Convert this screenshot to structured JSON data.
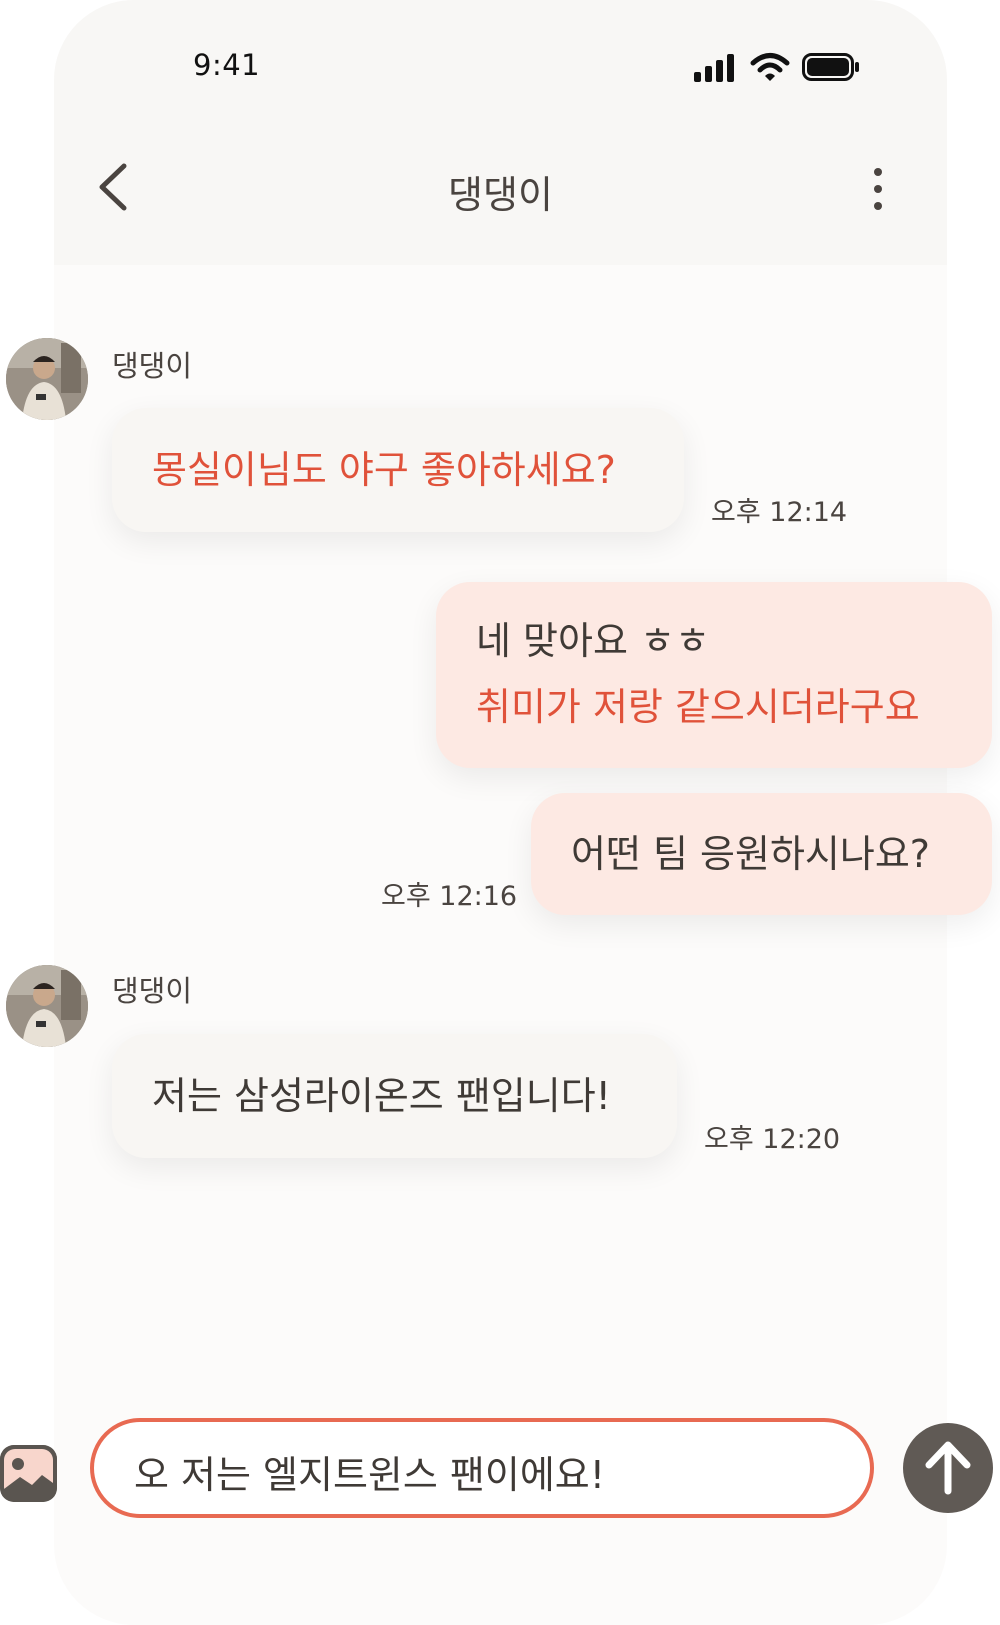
{
  "status_bar": {
    "time": "9:41"
  },
  "header": {
    "title": "댕댕이"
  },
  "messages": [
    {
      "sender": "댕댕이",
      "lines": [
        "몽실이님도 야구 좋아하세요?"
      ],
      "time": "오후 12:14"
    },
    {
      "lines": [
        "네 맞아요 ㅎㅎ",
        "취미가 저랑 같으시더라구요"
      ]
    },
    {
      "lines": [
        "어떤 팀 응원하시나요?"
      ],
      "time": "오후 12:16"
    },
    {
      "sender": "댕댕이",
      "lines": [
        "저는 삼성라이온즈 팬입니다!"
      ],
      "time": "오후 12:20"
    }
  ],
  "composer": {
    "value": "오 저는 엘지트윈스 팬이에요!"
  },
  "colors": {
    "accent": "#e0523a",
    "outgoing_bubble": "#fde9e3",
    "incoming_bubble": "#f8f6f3",
    "input_border": "#e86a52",
    "send_button": "#605a55"
  },
  "icons": [
    "back-icon",
    "more-vertical-icon",
    "signal-icon",
    "wifi-icon",
    "battery-icon",
    "photo-icon",
    "send-arrow-icon"
  ]
}
